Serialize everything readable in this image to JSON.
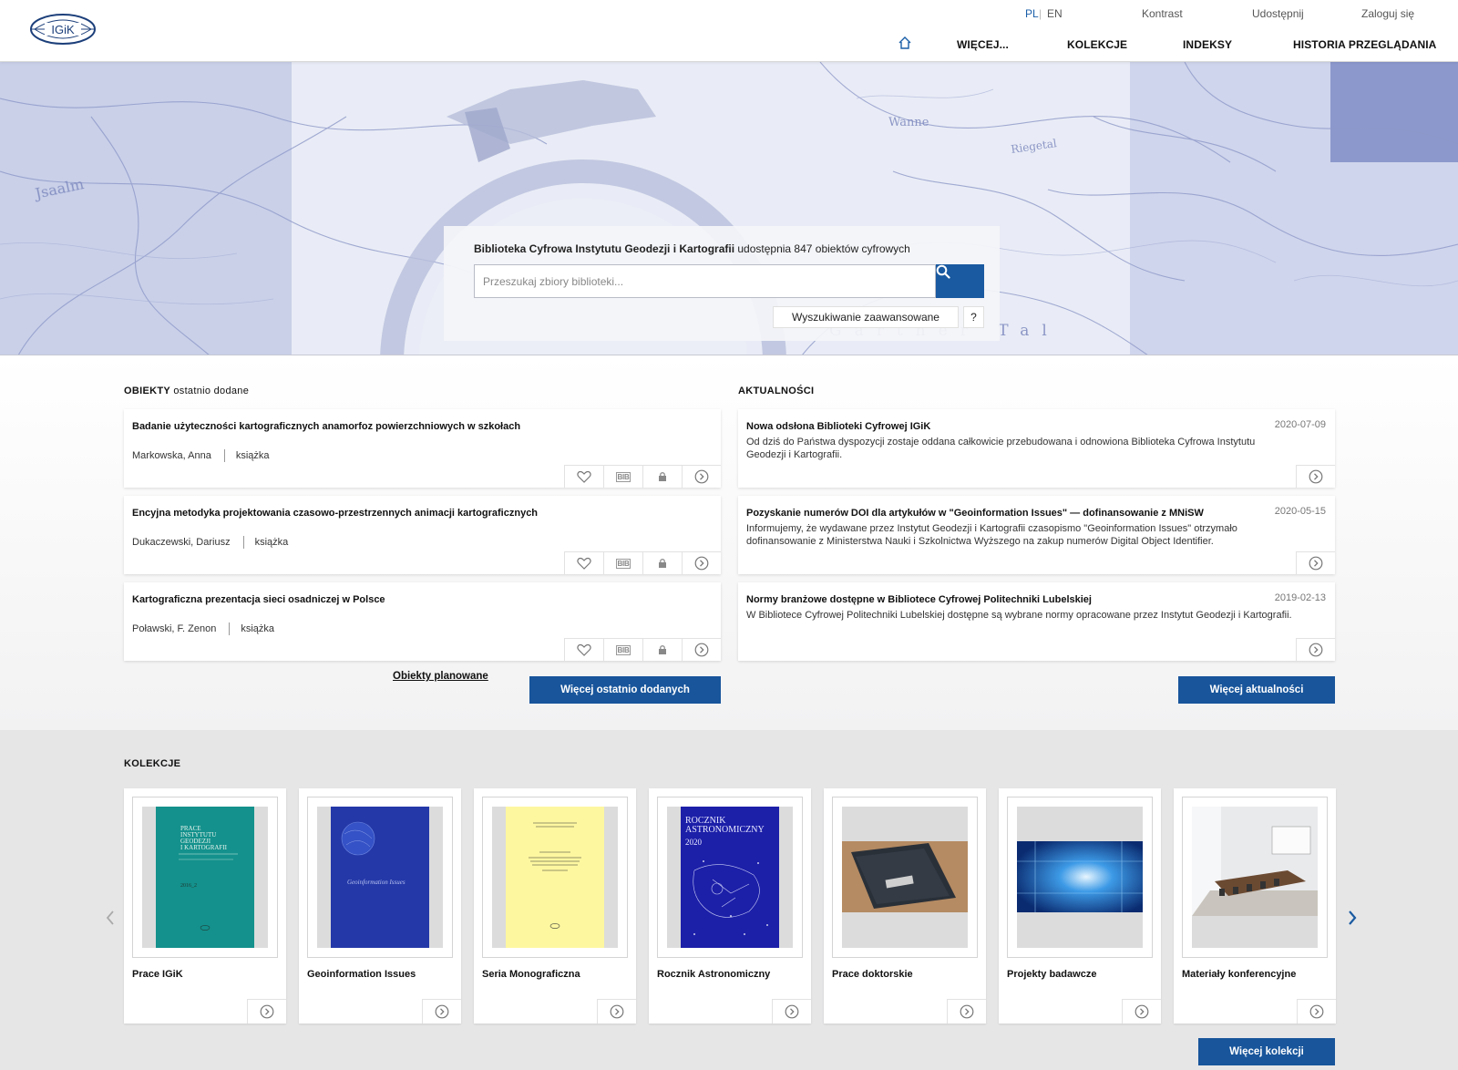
{
  "header": {
    "logo_text": "IGiK",
    "lang_pl": "PL",
    "lang_sep": "|",
    "lang_en": "EN",
    "contrast": "Kontrast",
    "share": "Udostępnij",
    "login": "Zaloguj się",
    "nav": {
      "more": "WIĘCEJ...",
      "collections": "KOLEKCJE",
      "indexes": "INDEKSY",
      "history": "HISTORIA PRZEGLĄDANIA"
    }
  },
  "search": {
    "title_bold": "Biblioteka Cyfrowa Instytutu Geodezji i Kartografii",
    "title_rest": " udostępnia 847 obiektów cyfrowych",
    "placeholder": "Przeszukaj zbiory biblioteki...",
    "advanced": "Wyszukiwanie zaawansowane",
    "help": "?"
  },
  "recent": {
    "title_bold": "OBIEKTY",
    "title_thin": " ostatnio dodane",
    "items": [
      {
        "title": "Badanie użyteczności kartograficznych anamorfoz powierzchniowych w szkołach",
        "author": "Markowska, Anna",
        "type": "książka"
      },
      {
        "title": "Encyjna metodyka projektowania czasowo-przestrzennych animacji kartograficznych",
        "author": "Dukaczewski, Dariusz",
        "type": "książka"
      },
      {
        "title": "Kartograficzna prezentacja sieci osadniczej w Polsce",
        "author": "Poławski, F. Zenon",
        "type": "książka"
      }
    ],
    "bib_label": "BIB",
    "planned_link": "Obiekty planowane",
    "more_button": "Więcej ostatnio dodanych"
  },
  "news": {
    "title": "AKTUALNOŚCI",
    "items": [
      {
        "title": "Nowa odsłona Biblioteki Cyfrowej IGiK",
        "date": "2020-07-09",
        "text": "Od dziś do Państwa dyspozycji zostaje oddana całkowicie przebudowana i odnowiona Biblioteka Cyfrowa Instytutu Geodezji i Kartografii."
      },
      {
        "title": "Pozyskanie numerów DOI dla artykułów w \"Geoinformation Issues\" — dofinansowanie z MNiSW",
        "date": "2020-05-15",
        "text": "Informujemy, że wydawane przez Instytut Geodezji i Kartografii czasopismo \"Geoinformation Issues\" otrzymało dofinansowanie z Ministerstwa Nauki i Szkolnictwa Wyższego na zakup numerów Digital Object Identifier."
      },
      {
        "title": "Normy branżowe dostępne w Bibliotece Cyfrowej Politechniki Lubelskiej",
        "date": "2019-02-13",
        "text": "W Bibliotece Cyfrowej Politechniki Lubelskiej dostępne są wybrane normy opracowane przez Instytut Geodezji i Kartografii."
      }
    ],
    "more_button": "Więcej aktualności"
  },
  "collections": {
    "title": "KOLEKCJE",
    "items": [
      {
        "name": "Prace IGiK",
        "cover_color": "#14918c",
        "cover_lines": [
          "PRACE",
          "INSTYTUTU",
          "GEODEZJI",
          "I KARTOGRAFII"
        ],
        "cover_number": "2016_2"
      },
      {
        "name": "Geoinformation Issues",
        "cover_color": "#2438a8",
        "cover_lines": [
          "Geoinformation Issues"
        ]
      },
      {
        "name": "Seria Monograficzna",
        "cover_color": "#fdf7a0"
      },
      {
        "name": "Rocznik Astronomiczny",
        "cover_color": "#1c1fa8",
        "cover_lines": [
          "ROCZNIK",
          "ASTRONOMICZNY",
          "2020"
        ]
      },
      {
        "name": "Prace doktorskie",
        "cover_color": "#6e6e6e"
      },
      {
        "name": "Projekty badawcze",
        "cover_color": "#1d5fa8"
      },
      {
        "name": "Materiały konferencyjne",
        "cover_color": "#c8c8c8"
      }
    ],
    "more_button": "Więcej kolekcji"
  },
  "colors": {
    "accent": "#18559b",
    "hero_tint": "#8a96c8"
  }
}
